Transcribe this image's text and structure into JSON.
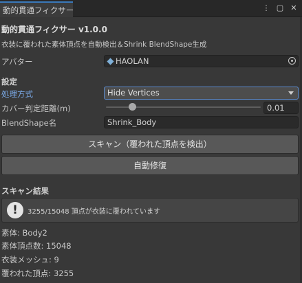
{
  "window": {
    "tab_title": "動的貫通フィクサー",
    "menu_icon": "kebab-menu-icon",
    "maximize_icon": "maximize-icon",
    "close_icon": "close-icon"
  },
  "header": {
    "title": "動的貫通フィクサー v1.0.0",
    "subtitle": "衣装に覆われた素体頂点を自動検出＆Shrink BlendShape生成"
  },
  "avatar": {
    "label": "アバター",
    "value": "HAOLAN",
    "value_icon": "gameobject-icon",
    "picker_icon": "object-picker-icon"
  },
  "settings": {
    "section_title": "設定",
    "method_label": "処理方式",
    "method_value": "Hide Vertices",
    "cover_label": "カバー判定距離(m)",
    "cover_value": "0.01",
    "cover_slider_fraction": 0.17,
    "blendshape_label": "BlendShape名",
    "blendshape_value": "Shrink_Body"
  },
  "buttons": {
    "scan_label": "スキャン（覆われた頂点を検出）",
    "repair_label": "自動修復"
  },
  "results": {
    "section_title": "スキャン結果",
    "message": "3255/15048 頂点が衣装に覆われています",
    "message_icon": "warning-icon",
    "body_mesh": "素体: Body2",
    "body_vertices": "素体頂点数: 15048",
    "clothing_meshes": "衣装メッシュ: 9",
    "covered_vertices": "覆われた頂点: 3255"
  },
  "colors": {
    "background": "#383838",
    "accent_blue": "#7aa9e6",
    "tab_highlight": "#3a79bb"
  }
}
